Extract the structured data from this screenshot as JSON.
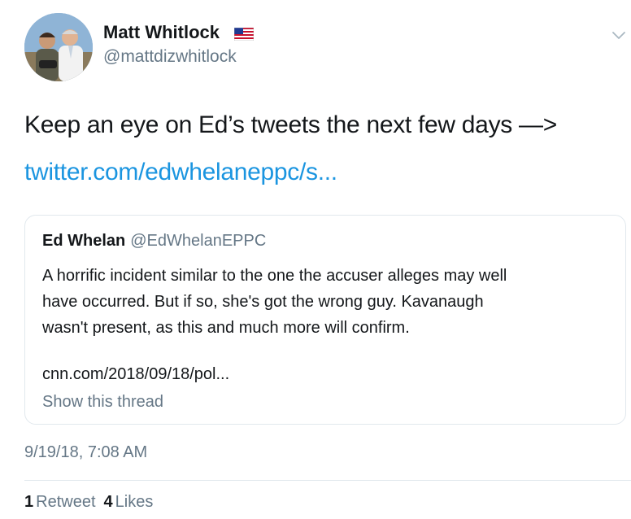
{
  "tweet": {
    "author": {
      "display_name": "Matt Whitlock",
      "handle": "@mattdizwhitlock",
      "badge_icon": "us-flag-icon"
    },
    "menu_icon": "chevron-down-icon",
    "text": "Keep an eye on Ed’s tweets the next few days —>",
    "link": "twitter.com/edwhelaneppc/s...",
    "quoted_tweet": {
      "author_name": "Ed Whelan",
      "author_handle": "@EdWhelanEPPC",
      "body_lines": [
        "A horrific incident similar to the one the accuser alleges may well",
        "have occurred. But if so, she's got the wrong guy. Kavanaugh",
        "wasn't present, as this and much more will confirm."
      ],
      "link": "cnn.com/2018/09/18/pol...",
      "show_thread": "Show this thread"
    },
    "timestamp": "9/19/18, 7:08 AM",
    "stats": {
      "retweets_count": "1",
      "retweets_label": "Retweet",
      "likes_count": "4",
      "likes_label": "Likes"
    }
  },
  "colors": {
    "text_primary": "#14171a",
    "text_secondary": "#657786",
    "link": "#1b95e0",
    "border": "#e1e8ed"
  }
}
